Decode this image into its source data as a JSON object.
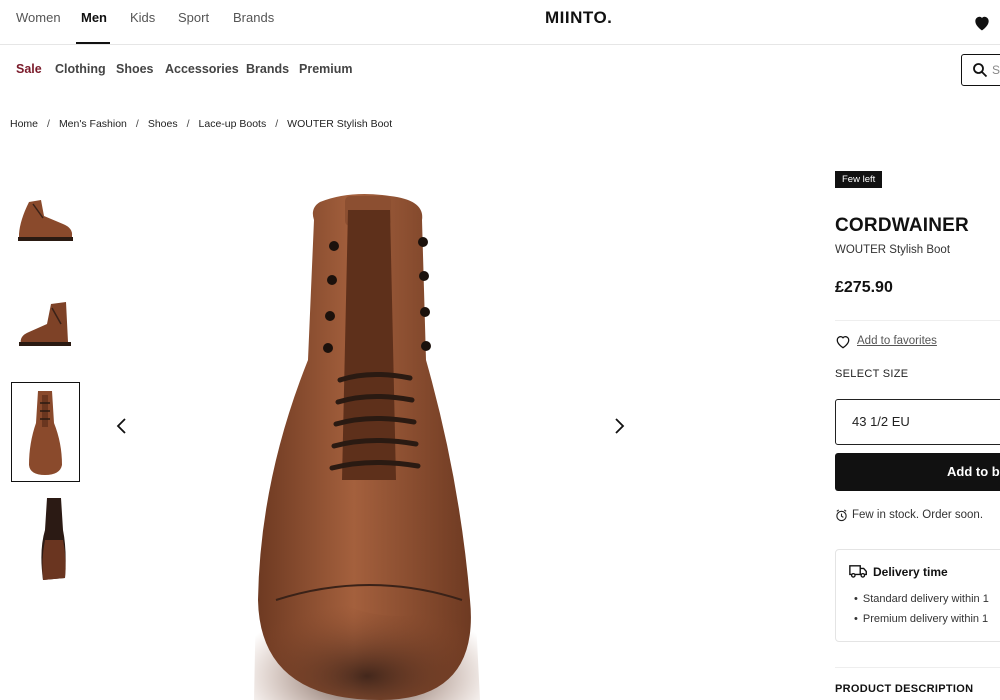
{
  "top_nav": {
    "items": [
      "Women",
      "Men",
      "Kids",
      "Sport",
      "Brands"
    ],
    "active": "Men",
    "logo": "MIINTO."
  },
  "category_nav": {
    "items": [
      "Sale",
      "Clothing",
      "Shoes",
      "Accessories",
      "Brands",
      "Premium"
    ]
  },
  "search": {
    "placeholder": "S"
  },
  "breadcrumb": [
    "Home",
    "Men's Fashion",
    "Shoes",
    "Lace-up Boots",
    "WOUTER Stylish Boot"
  ],
  "breadcrumb_sep": "/",
  "gallery": {
    "thumbnail_count": 4,
    "selected_index": 2
  },
  "product": {
    "badge": "Few left",
    "brand": "CORDWAINER",
    "name": "WOUTER Stylish Boot",
    "price": "£275.90",
    "add_to_favorites": "Add to favorites",
    "select_size_label": "SELECT SIZE",
    "selected_size": "43 1/2 EU",
    "add_button": "Add to ba",
    "stock_note": "Few in stock. Order soon.",
    "delivery": {
      "title": "Delivery time",
      "items": [
        "Standard delivery within 1",
        "Premium delivery within 1"
      ]
    },
    "description_heading": "PRODUCT DESCRIPTION"
  },
  "colors": {
    "sale": "#7a1a2a",
    "button": "#111111",
    "leather": "#8a4a2c"
  }
}
